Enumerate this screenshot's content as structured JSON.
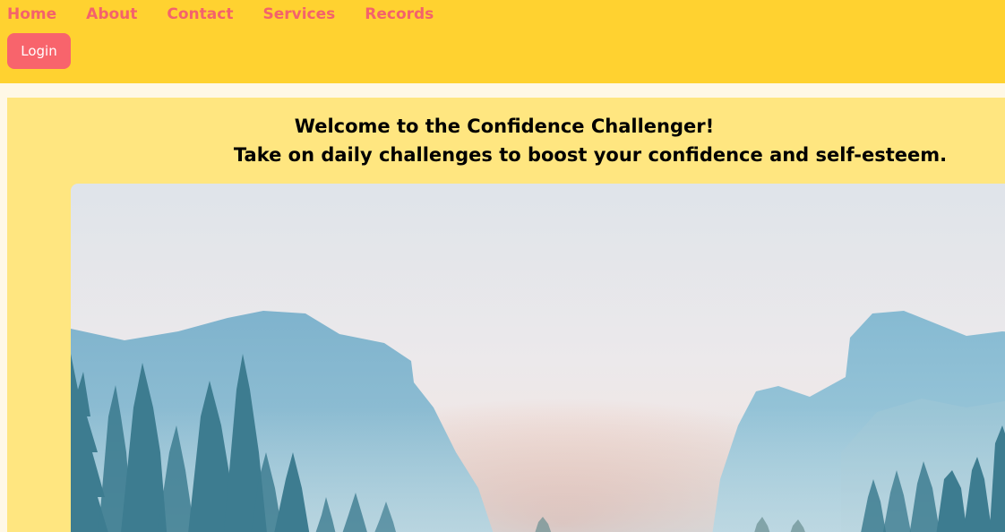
{
  "nav": {
    "items": [
      {
        "label": "Home"
      },
      {
        "label": "About"
      },
      {
        "label": "Contact"
      },
      {
        "label": "Services"
      },
      {
        "label": "Records"
      }
    ],
    "login_label": "Login"
  },
  "main": {
    "welcome_line1": "Welcome to the Confidence Challenger!",
    "welcome_line2": "Take on daily challenges to boost your confidence and self-esteem."
  },
  "colors": {
    "header_bg": "#ffd230",
    "nav_text": "#f4626b",
    "login_bg": "#f8646c",
    "main_bg": "#ffe680",
    "page_bg": "#fff8e6"
  }
}
